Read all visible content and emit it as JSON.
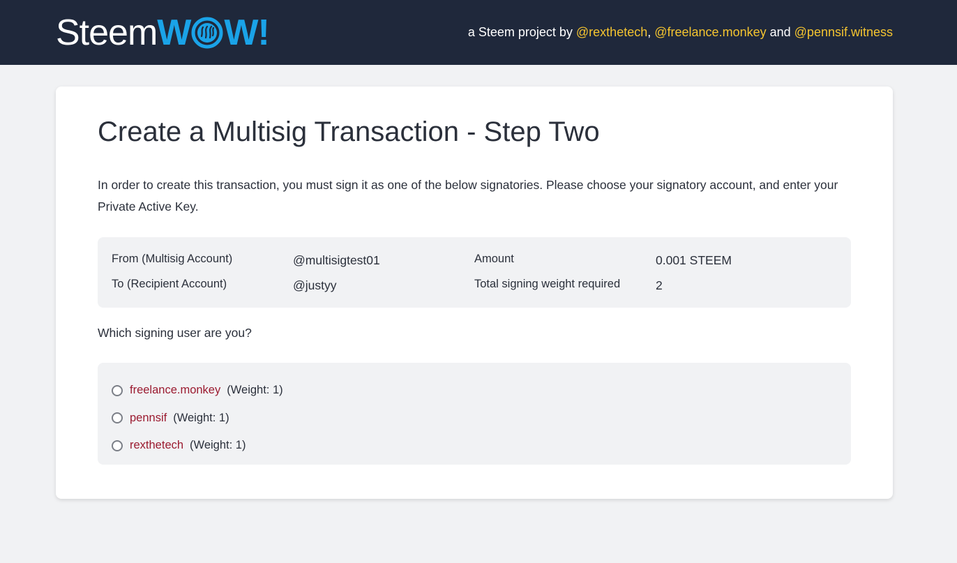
{
  "header": {
    "logo_part1": "Steem",
    "logo_part2_w1": "W",
    "logo_part2_w2": "W!",
    "logo_o_icon": "steem-logo-icon",
    "byline_prefix": "a Steem project by ",
    "author1": "@rexthetech",
    "sep1": ", ",
    "author2": "@freelance.monkey",
    "sep2": " and ",
    "author3": "@pennsif.witness"
  },
  "main": {
    "title": "Create a Multisig Transaction - Step Two",
    "intro": "In order to create this transaction, you must sign it as one of the below signatories. Please choose your signatory account, and enter your Private Active Key.",
    "summary": {
      "from_label": "From (Multisig Account)",
      "from_value": "@multisigtest01",
      "to_label": "To (Recipient Account)",
      "to_value": "@justyy",
      "amount_label": "Amount",
      "amount_value": "0.001 STEEM",
      "weight_label": "Total signing weight required",
      "weight_value": "2"
    },
    "question": "Which signing user are you?",
    "signers": [
      {
        "name": "freelance.monkey",
        "weight": "(Weight: 1)"
      },
      {
        "name": "pennsif",
        "weight": "(Weight: 1)"
      },
      {
        "name": "rexthetech",
        "weight": "(Weight: 1)"
      }
    ]
  },
  "colors": {
    "header_bg": "#1f283b",
    "brand_blue": "#1aa3e8",
    "link_yellow": "#f4c430",
    "signer_red": "#9b1b30",
    "page_bg": "#f1f2f4"
  }
}
